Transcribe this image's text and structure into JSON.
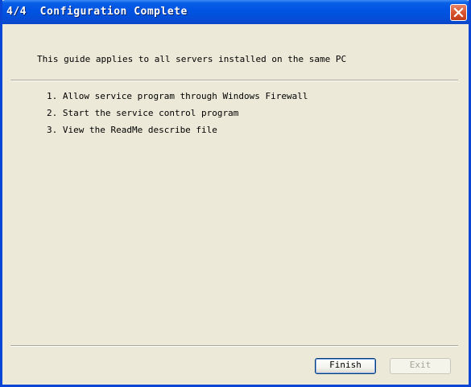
{
  "window": {
    "title": "4/4  Configuration Complete",
    "close_icon": "close-icon",
    "accent_color": "#0054e3",
    "close_color": "#d9542f"
  },
  "main": {
    "intro": "This guide applies to all servers installed on the same PC",
    "steps": [
      "1. Allow service program through Windows Firewall",
      "2. Start the service control program",
      "3. View the ReadMe describe file"
    ]
  },
  "footer": {
    "finish_label": "Finish",
    "exit_label": "Exit",
    "exit_disabled": true
  }
}
